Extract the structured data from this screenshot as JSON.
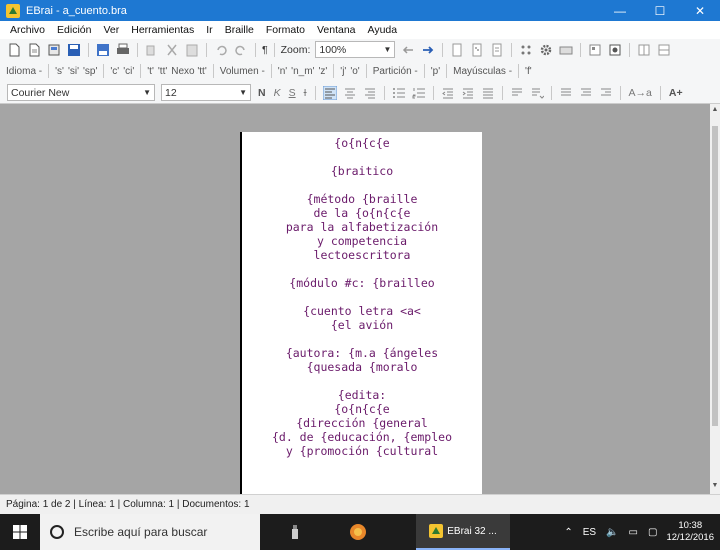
{
  "window": {
    "title": "EBrai - a_cuento.bra",
    "minimize_label": "—",
    "maximize_label": "☐",
    "close_label": "✕",
    "accent": "#1e78d2"
  },
  "menubar": {
    "items": [
      "Archivo",
      "Edición",
      "Ver",
      "Herramientas",
      "Ir",
      "Braille",
      "Formato",
      "Ventana",
      "Ayuda"
    ]
  },
  "toolbar1": {
    "paragraph": "¶",
    "zoom_label": "Zoom:",
    "zoom_value": "100%"
  },
  "toolbar2": {
    "items": [
      "Idioma -",
      "'s'",
      "'si'",
      "'sp'",
      "'c'",
      "'ci'",
      "'t'",
      "'tt'",
      "Nexo 'tt'",
      "Volumen -",
      "'n'",
      "'n_m'",
      "'z'",
      "'j'",
      "'o'",
      "Partición -",
      "'p'",
      "Mayúsculas -",
      "'f'"
    ]
  },
  "toolbar3": {
    "font_name": "Courier New",
    "font_size": "12",
    "bold": "N",
    "italic": "K",
    "underline": "S",
    "strike": "I",
    "case_label": "A→a",
    "grow_label": "A+"
  },
  "document": {
    "text_color": "#6a1a6a",
    "lines": [
      "{o{n{c{e",
      "",
      "{braitico",
      "",
      "{método {braille",
      "de la {o{n{c{e",
      "para la alfabetización",
      "y competencia",
      "lectoescritora",
      "",
      "{módulo #c: {brailleo",
      "",
      "{cuento letra <a<",
      "{el avión",
      "",
      "{autora: {m.a {ángeles",
      "{quesada {moralo",
      "",
      "{edita:",
      "{o{n{c{e",
      "{dirección {general",
      "{d. de {educación, {empleo",
      "y {promoción {cultural"
    ]
  },
  "statusbar": {
    "page": "Página: 1 de 2",
    "line": "Línea: 1",
    "column": "Columna: 1",
    "documents": "Documentos: 1"
  },
  "taskbar": {
    "search_placeholder": "Escribe aquí para buscar",
    "active_app_label": "EBrai 32 ...",
    "language": "ES",
    "time": "10:38",
    "date": "12/12/2016"
  }
}
